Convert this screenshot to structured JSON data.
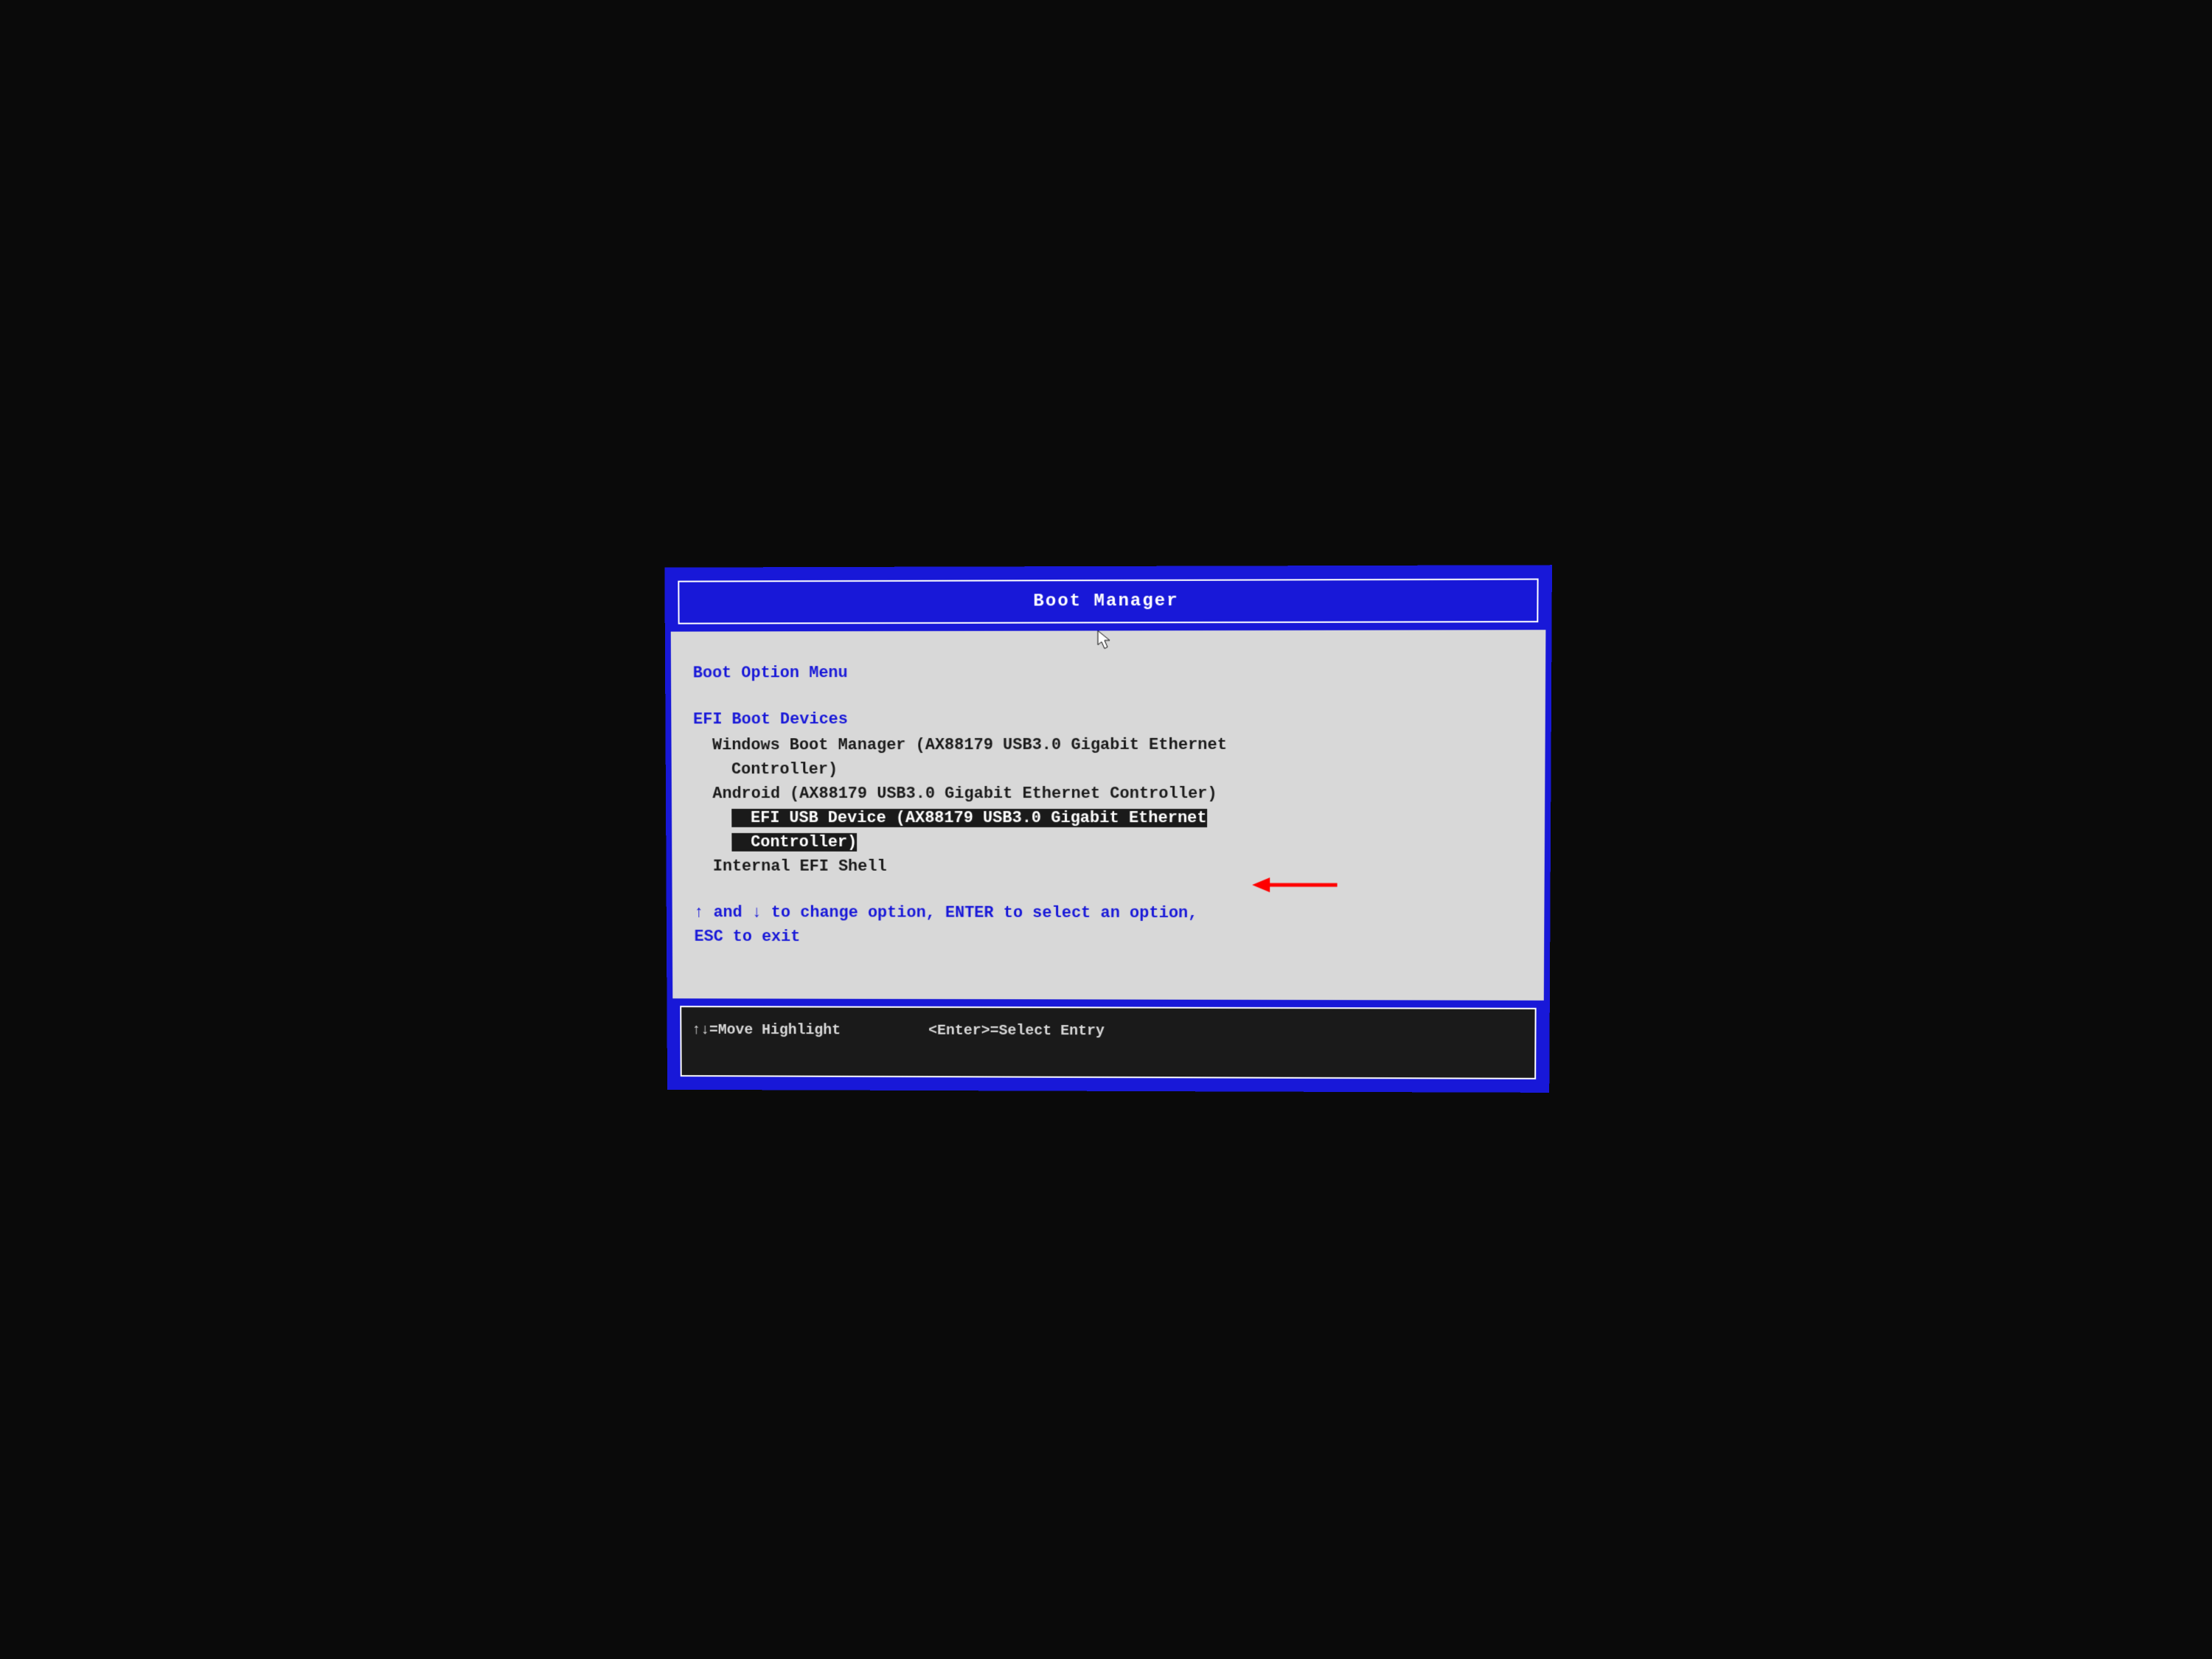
{
  "header": {
    "title": "Boot Manager"
  },
  "menu": {
    "title": "Boot Option Menu",
    "section_title": "EFI Boot Devices",
    "items": [
      {
        "label": "Windows Boot Manager (AX88179 USB3.0 Gigabit Ethernet Controller)",
        "selected": false
      },
      {
        "label": "Android (AX88179 USB3.0 Gigabit Ethernet Controller)",
        "selected": false
      },
      {
        "label": "EFI USB Device (AX88179 USB3.0 Gigabit Ethernet Controller)",
        "selected": true
      },
      {
        "label": "Internal EFI Shell",
        "selected": false
      }
    ],
    "help_text": "↑ and ↓ to change option, ENTER to select an option, ESC to exit"
  },
  "footer": {
    "move_hint": "↑↓=Move Highlight",
    "select_hint": "<Enter>=Select Entry"
  }
}
